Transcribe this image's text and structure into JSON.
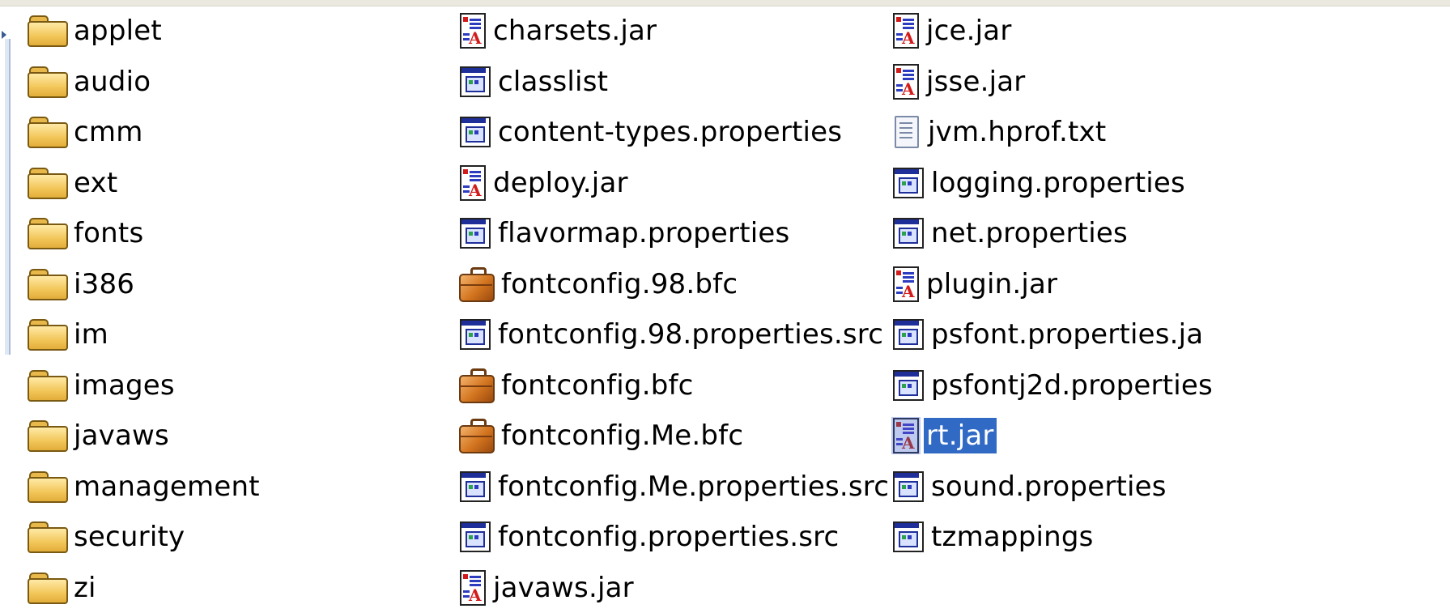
{
  "columns": [
    {
      "items": [
        {
          "name": "applet",
          "type": "folder"
        },
        {
          "name": "audio",
          "type": "folder"
        },
        {
          "name": "cmm",
          "type": "folder"
        },
        {
          "name": "ext",
          "type": "folder"
        },
        {
          "name": "fonts",
          "type": "folder"
        },
        {
          "name": "i386",
          "type": "folder"
        },
        {
          "name": "im",
          "type": "folder"
        },
        {
          "name": "images",
          "type": "folder"
        },
        {
          "name": "javaws",
          "type": "folder"
        },
        {
          "name": "management",
          "type": "folder"
        },
        {
          "name": "security",
          "type": "folder"
        },
        {
          "name": "zi",
          "type": "folder"
        }
      ]
    },
    {
      "items": [
        {
          "name": "charsets.jar",
          "type": "jar"
        },
        {
          "name": "classlist",
          "type": "properties"
        },
        {
          "name": "content-types.properties",
          "type": "properties"
        },
        {
          "name": "deploy.jar",
          "type": "jar"
        },
        {
          "name": "flavormap.properties",
          "type": "properties"
        },
        {
          "name": "fontconfig.98.bfc",
          "type": "bfc"
        },
        {
          "name": "fontconfig.98.properties.src",
          "type": "properties"
        },
        {
          "name": "fontconfig.bfc",
          "type": "bfc"
        },
        {
          "name": "fontconfig.Me.bfc",
          "type": "bfc"
        },
        {
          "name": "fontconfig.Me.properties.src",
          "type": "properties"
        },
        {
          "name": "fontconfig.properties.src",
          "type": "properties"
        },
        {
          "name": "javaws.jar",
          "type": "jar"
        }
      ]
    },
    {
      "items": [
        {
          "name": "jce.jar",
          "type": "jar"
        },
        {
          "name": "jsse.jar",
          "type": "jar"
        },
        {
          "name": "jvm.hprof.txt",
          "type": "txt"
        },
        {
          "name": "logging.properties",
          "type": "properties"
        },
        {
          "name": "net.properties",
          "type": "properties"
        },
        {
          "name": "plugin.jar",
          "type": "jar"
        },
        {
          "name": "psfont.properties.ja",
          "type": "properties"
        },
        {
          "name": "psfontj2d.properties",
          "type": "properties"
        },
        {
          "name": "rt.jar",
          "type": "jar",
          "selected": true
        },
        {
          "name": "sound.properties",
          "type": "properties"
        },
        {
          "name": "tzmappings",
          "type": "properties"
        }
      ]
    }
  ],
  "icons": {
    "folder": "folder-icon",
    "jar": "jar-file-icon",
    "properties": "properties-file-icon",
    "bfc": "briefcase-file-icon",
    "txt": "text-file-icon"
  },
  "colors": {
    "selection": "#316ac5",
    "selection_text": "#ffffff"
  }
}
